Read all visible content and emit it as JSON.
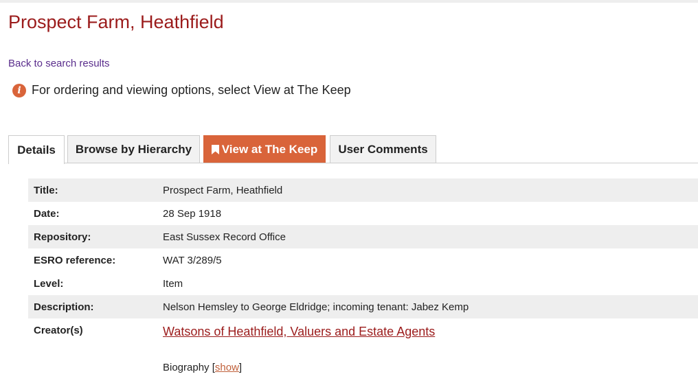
{
  "page": {
    "title": "Prospect Farm, Heathfield",
    "back_link": "Back to search results",
    "notice": "For ordering and viewing options, select View at The Keep",
    "notice_icon": "info-icon"
  },
  "tabs": [
    {
      "label": "Details",
      "active": true
    },
    {
      "label": "Browse by Hierarchy",
      "active": false
    },
    {
      "label": "View at The Keep",
      "icon": "bookmark-icon",
      "highlight": true
    },
    {
      "label": "User Comments",
      "active": false
    }
  ],
  "details": [
    {
      "label": "Title:",
      "value": "Prospect Farm, Heathfield"
    },
    {
      "label": "Date:",
      "value": "28 Sep 1918"
    },
    {
      "label": "Repository:",
      "value": "East Sussex Record Office"
    },
    {
      "label": "ESRO reference:",
      "value": "WAT 3/289/5"
    },
    {
      "label": "Level:",
      "value": "Item"
    },
    {
      "label": "Description:",
      "value": "Nelson Hemsley to George Eldridge; incoming tenant: Jabez Kemp"
    }
  ],
  "creator": {
    "label": "Creator(s)",
    "name": "Watsons of Heathfield, Valuers and Estate Agents",
    "biography_label": "Biography [",
    "show_label": "show",
    "biography_close": "]"
  },
  "colors": {
    "title": "#9b1b1b",
    "accent": "#d9643a",
    "link": "#5a2d8c",
    "row_shade": "#eeeeee"
  }
}
